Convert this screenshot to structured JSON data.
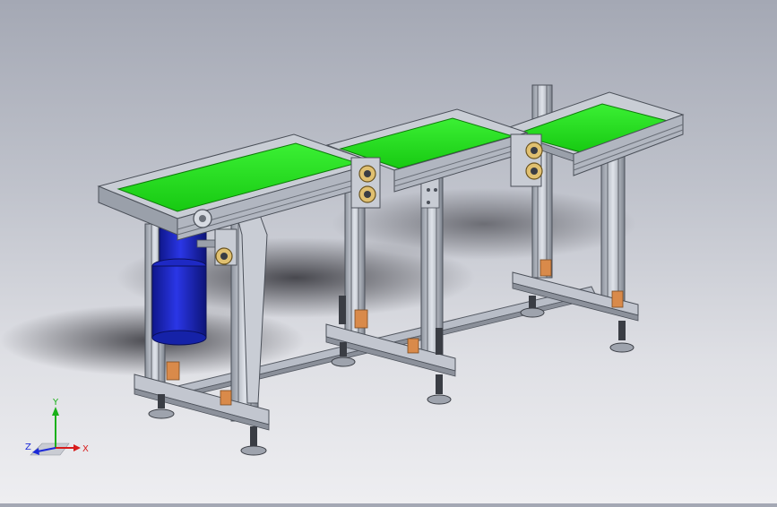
{
  "viewport": {
    "background_top": "#a4a8b4",
    "background_bottom": "#eeeef1",
    "model": {
      "belt_color": "#22e01c",
      "frame_color": "#b7bcc6",
      "motor_color": "#1a24c8",
      "bracket_color": "#d98a4a"
    }
  },
  "triad": {
    "x_label": "X",
    "y_label": "Y",
    "z_label": "Z",
    "x_color": "#d81c1c",
    "y_color": "#19b019",
    "z_color": "#1c2ad8"
  }
}
